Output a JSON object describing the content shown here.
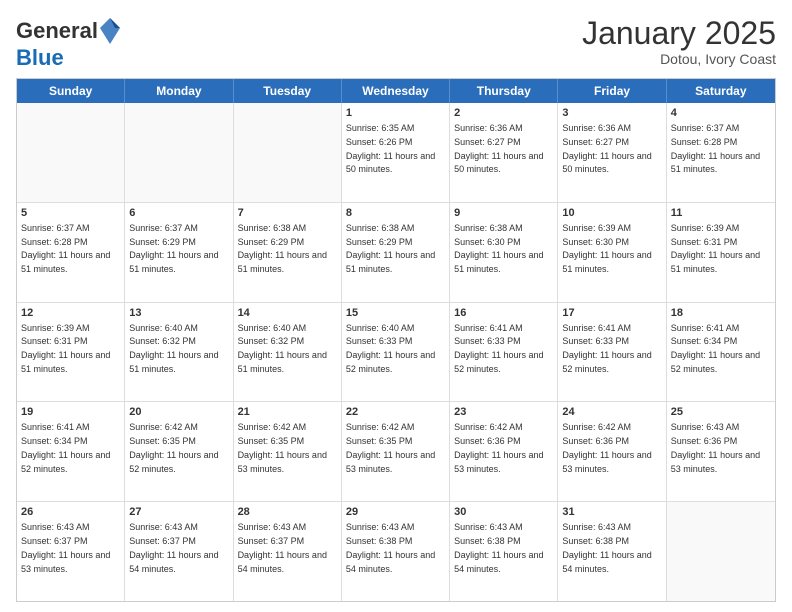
{
  "header": {
    "logo_general": "General",
    "logo_blue": "Blue",
    "month_title": "January 2025",
    "location": "Dotou, Ivory Coast"
  },
  "days_of_week": [
    "Sunday",
    "Monday",
    "Tuesday",
    "Wednesday",
    "Thursday",
    "Friday",
    "Saturday"
  ],
  "weeks": [
    [
      {
        "day": "",
        "info": ""
      },
      {
        "day": "",
        "info": ""
      },
      {
        "day": "",
        "info": ""
      },
      {
        "day": "1",
        "info": "Sunrise: 6:35 AM\nSunset: 6:26 PM\nDaylight: 11 hours and 50 minutes."
      },
      {
        "day": "2",
        "info": "Sunrise: 6:36 AM\nSunset: 6:27 PM\nDaylight: 11 hours and 50 minutes."
      },
      {
        "day": "3",
        "info": "Sunrise: 6:36 AM\nSunset: 6:27 PM\nDaylight: 11 hours and 50 minutes."
      },
      {
        "day": "4",
        "info": "Sunrise: 6:37 AM\nSunset: 6:28 PM\nDaylight: 11 hours and 51 minutes."
      }
    ],
    [
      {
        "day": "5",
        "info": "Sunrise: 6:37 AM\nSunset: 6:28 PM\nDaylight: 11 hours and 51 minutes."
      },
      {
        "day": "6",
        "info": "Sunrise: 6:37 AM\nSunset: 6:29 PM\nDaylight: 11 hours and 51 minutes."
      },
      {
        "day": "7",
        "info": "Sunrise: 6:38 AM\nSunset: 6:29 PM\nDaylight: 11 hours and 51 minutes."
      },
      {
        "day": "8",
        "info": "Sunrise: 6:38 AM\nSunset: 6:29 PM\nDaylight: 11 hours and 51 minutes."
      },
      {
        "day": "9",
        "info": "Sunrise: 6:38 AM\nSunset: 6:30 PM\nDaylight: 11 hours and 51 minutes."
      },
      {
        "day": "10",
        "info": "Sunrise: 6:39 AM\nSunset: 6:30 PM\nDaylight: 11 hours and 51 minutes."
      },
      {
        "day": "11",
        "info": "Sunrise: 6:39 AM\nSunset: 6:31 PM\nDaylight: 11 hours and 51 minutes."
      }
    ],
    [
      {
        "day": "12",
        "info": "Sunrise: 6:39 AM\nSunset: 6:31 PM\nDaylight: 11 hours and 51 minutes."
      },
      {
        "day": "13",
        "info": "Sunrise: 6:40 AM\nSunset: 6:32 PM\nDaylight: 11 hours and 51 minutes."
      },
      {
        "day": "14",
        "info": "Sunrise: 6:40 AM\nSunset: 6:32 PM\nDaylight: 11 hours and 51 minutes."
      },
      {
        "day": "15",
        "info": "Sunrise: 6:40 AM\nSunset: 6:33 PM\nDaylight: 11 hours and 52 minutes."
      },
      {
        "day": "16",
        "info": "Sunrise: 6:41 AM\nSunset: 6:33 PM\nDaylight: 11 hours and 52 minutes."
      },
      {
        "day": "17",
        "info": "Sunrise: 6:41 AM\nSunset: 6:33 PM\nDaylight: 11 hours and 52 minutes."
      },
      {
        "day": "18",
        "info": "Sunrise: 6:41 AM\nSunset: 6:34 PM\nDaylight: 11 hours and 52 minutes."
      }
    ],
    [
      {
        "day": "19",
        "info": "Sunrise: 6:41 AM\nSunset: 6:34 PM\nDaylight: 11 hours and 52 minutes."
      },
      {
        "day": "20",
        "info": "Sunrise: 6:42 AM\nSunset: 6:35 PM\nDaylight: 11 hours and 52 minutes."
      },
      {
        "day": "21",
        "info": "Sunrise: 6:42 AM\nSunset: 6:35 PM\nDaylight: 11 hours and 53 minutes."
      },
      {
        "day": "22",
        "info": "Sunrise: 6:42 AM\nSunset: 6:35 PM\nDaylight: 11 hours and 53 minutes."
      },
      {
        "day": "23",
        "info": "Sunrise: 6:42 AM\nSunset: 6:36 PM\nDaylight: 11 hours and 53 minutes."
      },
      {
        "day": "24",
        "info": "Sunrise: 6:42 AM\nSunset: 6:36 PM\nDaylight: 11 hours and 53 minutes."
      },
      {
        "day": "25",
        "info": "Sunrise: 6:43 AM\nSunset: 6:36 PM\nDaylight: 11 hours and 53 minutes."
      }
    ],
    [
      {
        "day": "26",
        "info": "Sunrise: 6:43 AM\nSunset: 6:37 PM\nDaylight: 11 hours and 53 minutes."
      },
      {
        "day": "27",
        "info": "Sunrise: 6:43 AM\nSunset: 6:37 PM\nDaylight: 11 hours and 54 minutes."
      },
      {
        "day": "28",
        "info": "Sunrise: 6:43 AM\nSunset: 6:37 PM\nDaylight: 11 hours and 54 minutes."
      },
      {
        "day": "29",
        "info": "Sunrise: 6:43 AM\nSunset: 6:38 PM\nDaylight: 11 hours and 54 minutes."
      },
      {
        "day": "30",
        "info": "Sunrise: 6:43 AM\nSunset: 6:38 PM\nDaylight: 11 hours and 54 minutes."
      },
      {
        "day": "31",
        "info": "Sunrise: 6:43 AM\nSunset: 6:38 PM\nDaylight: 11 hours and 54 minutes."
      },
      {
        "day": "",
        "info": ""
      }
    ]
  ]
}
